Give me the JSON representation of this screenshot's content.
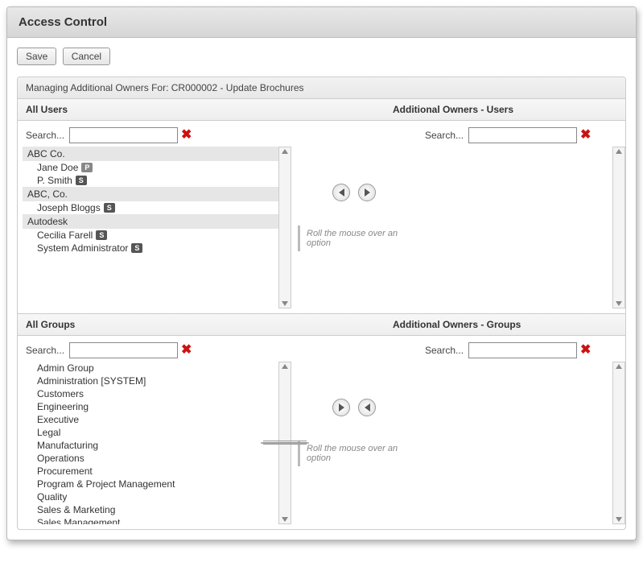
{
  "title": "Access Control",
  "buttons": {
    "save": "Save",
    "cancel": "Cancel"
  },
  "managing_label": "Managing Additional Owners For: CR000002 - Update Brochures",
  "users": {
    "left_header": "All Users",
    "right_header": "Additional Owners - Users",
    "search_label": "Search...",
    "groups": [
      {
        "name": "ABC Co.",
        "items": [
          {
            "name": "Jane Doe",
            "tag": "P"
          },
          {
            "name": "P. Smith",
            "tag": "S"
          }
        ]
      },
      {
        "name": "ABC, Co.",
        "items": [
          {
            "name": "Joseph Bloggs",
            "tag": "S"
          }
        ]
      },
      {
        "name": "Autodesk",
        "items": [
          {
            "name": "Cecilia Farell",
            "tag": "S"
          },
          {
            "name": "System Administrator",
            "tag": "S"
          }
        ]
      }
    ],
    "hint": "Roll the mouse over an option"
  },
  "groups_section": {
    "left_header": "All Groups",
    "right_header": "Additional Owners - Groups",
    "search_label": "Search...",
    "items": [
      "Admin Group",
      "Administration [SYSTEM]",
      "Customers",
      "Engineering",
      "Executive",
      "Legal",
      "Manufacturing",
      "Operations",
      "Procurement",
      "Program & Project Management",
      "Quality",
      "Sales & Marketing",
      "Sales Management"
    ],
    "hint": "Roll the mouse over an option"
  }
}
